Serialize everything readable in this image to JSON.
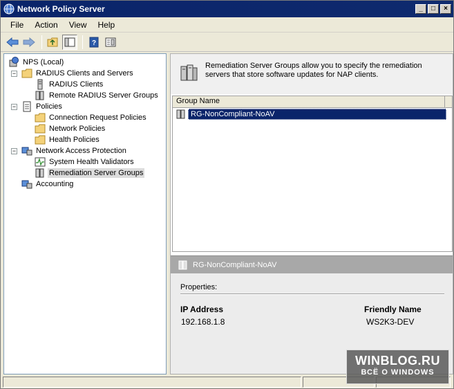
{
  "window": {
    "title": "Network Policy Server",
    "minimize_glyph": "_",
    "maximize_glyph": "□",
    "close_glyph": "×"
  },
  "menu": {
    "items": [
      {
        "label": "File"
      },
      {
        "label": "Action"
      },
      {
        "label": "View"
      },
      {
        "label": "Help"
      }
    ]
  },
  "toolbar": {
    "icons": [
      "back-arrow-icon",
      "forward-arrow-icon",
      "up-folder-icon",
      "show-hide-tree-icon",
      "help-icon",
      "properties-pane-icon"
    ]
  },
  "tree": {
    "items": [
      {
        "label": "NPS (Local)",
        "icon": "nps-server-icon"
      },
      {
        "label": "RADIUS Clients and Servers",
        "icon": "folder-icon"
      },
      {
        "label": "RADIUS Clients",
        "icon": "server-icon"
      },
      {
        "label": "Remote RADIUS Server Groups",
        "icon": "server-group-icon"
      },
      {
        "label": "Policies",
        "icon": "policies-icon"
      },
      {
        "label": "Connection Request Policies",
        "icon": "folder-icon"
      },
      {
        "label": "Network Policies",
        "icon": "folder-icon"
      },
      {
        "label": "Health Policies",
        "icon": "folder-icon"
      },
      {
        "label": "Network Access Protection",
        "icon": "nap-icon"
      },
      {
        "label": "System Health Validators",
        "icon": "health-validator-icon"
      },
      {
        "label": "Remediation Server Groups",
        "icon": "server-group-icon"
      },
      {
        "label": "Accounting",
        "icon": "accounting-icon"
      }
    ],
    "expander_minus": "−"
  },
  "main": {
    "description": "Remediation Server Groups allow you to specify the remediation servers that store software updates for NAP clients.",
    "columns": [
      {
        "label": "Group Name"
      }
    ],
    "rows": [
      {
        "name": "RG-NonCompliant-NoAV"
      }
    ]
  },
  "detail": {
    "title": "RG-NonCompliant-NoAV",
    "properties_label": "Properties:",
    "ip_header": "IP Address",
    "ip_value": "192.168.1.8",
    "friendly_header": "Friendly Name",
    "friendly_value": "WS2K3-DEV"
  },
  "watermark": {
    "main": "WINBLOG.RU",
    "sub": "ВСЁ О WINDOWS"
  },
  "colors": {
    "title_bar": "#0a246a",
    "selection": "#0a246a",
    "detail_header": "#a8a8a8"
  }
}
